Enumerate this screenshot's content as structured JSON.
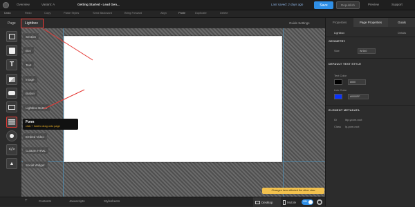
{
  "topbar": {
    "overview": "Overview",
    "variant": "Variant: A",
    "page_title": "Getting Started - Lead Gen...",
    "last_saved": "Last saved: 2 days ago",
    "save": "Save",
    "publish": "Republish",
    "preview": "Preview",
    "support": "Support"
  },
  "toolbar": {
    "undo": "Undo",
    "redo": "Redo",
    "items": [
      "Copy",
      "Paste Styles",
      "Send Backward",
      "Bring Forward",
      "Align",
      "Paste",
      "Duplicate",
      "Delete"
    ]
  },
  "tabs": {
    "page": "Page",
    "lightbox": "Lightbox",
    "guide_settings": "Guide Settings"
  },
  "elements": [
    "Section",
    "Box",
    "Text",
    "Image",
    "Button",
    "Lightbox Button",
    "Form",
    "Embed Video",
    "Custom HTML",
    "Social Widget"
  ],
  "tooltip": {
    "title": "Form",
    "subtitle": "click + hold to drag onto page"
  },
  "right_panel": {
    "tabs": [
      "Properties",
      "Page Properties",
      "Goals"
    ],
    "lightbox_label": "Lightbox",
    "details": "Details",
    "geometry": "GEOMETRY",
    "size_label": "Size",
    "size_w": "W",
    "size_value": "640",
    "default_text_style": "DEFAULT TEXT STYLE",
    "text_color_label": "Text Color",
    "text_color_value": "#000",
    "link_color_label": "Link Color",
    "link_color_value": "#0000FF",
    "element_metadata": "ELEMENT METADATA",
    "id_label": "ID",
    "id_value": "lbp-ycom-root",
    "class_label": "Class",
    "class_value": "lp-pom-root"
  },
  "bottom": {
    "contents": "Contents",
    "javascripts": "Javascripts",
    "stylesheets": "Stylesheets",
    "desktop": "Desktop",
    "mobile": "Mobile",
    "toggle": "ON"
  },
  "notice": "Changes here affected the other view",
  "colors": {
    "accent": "#2f8fe6",
    "highlight": "#e53935",
    "notice_bg": "#f2c14e",
    "text_swatch": "#000000",
    "link_swatch": "#0a33ff"
  }
}
